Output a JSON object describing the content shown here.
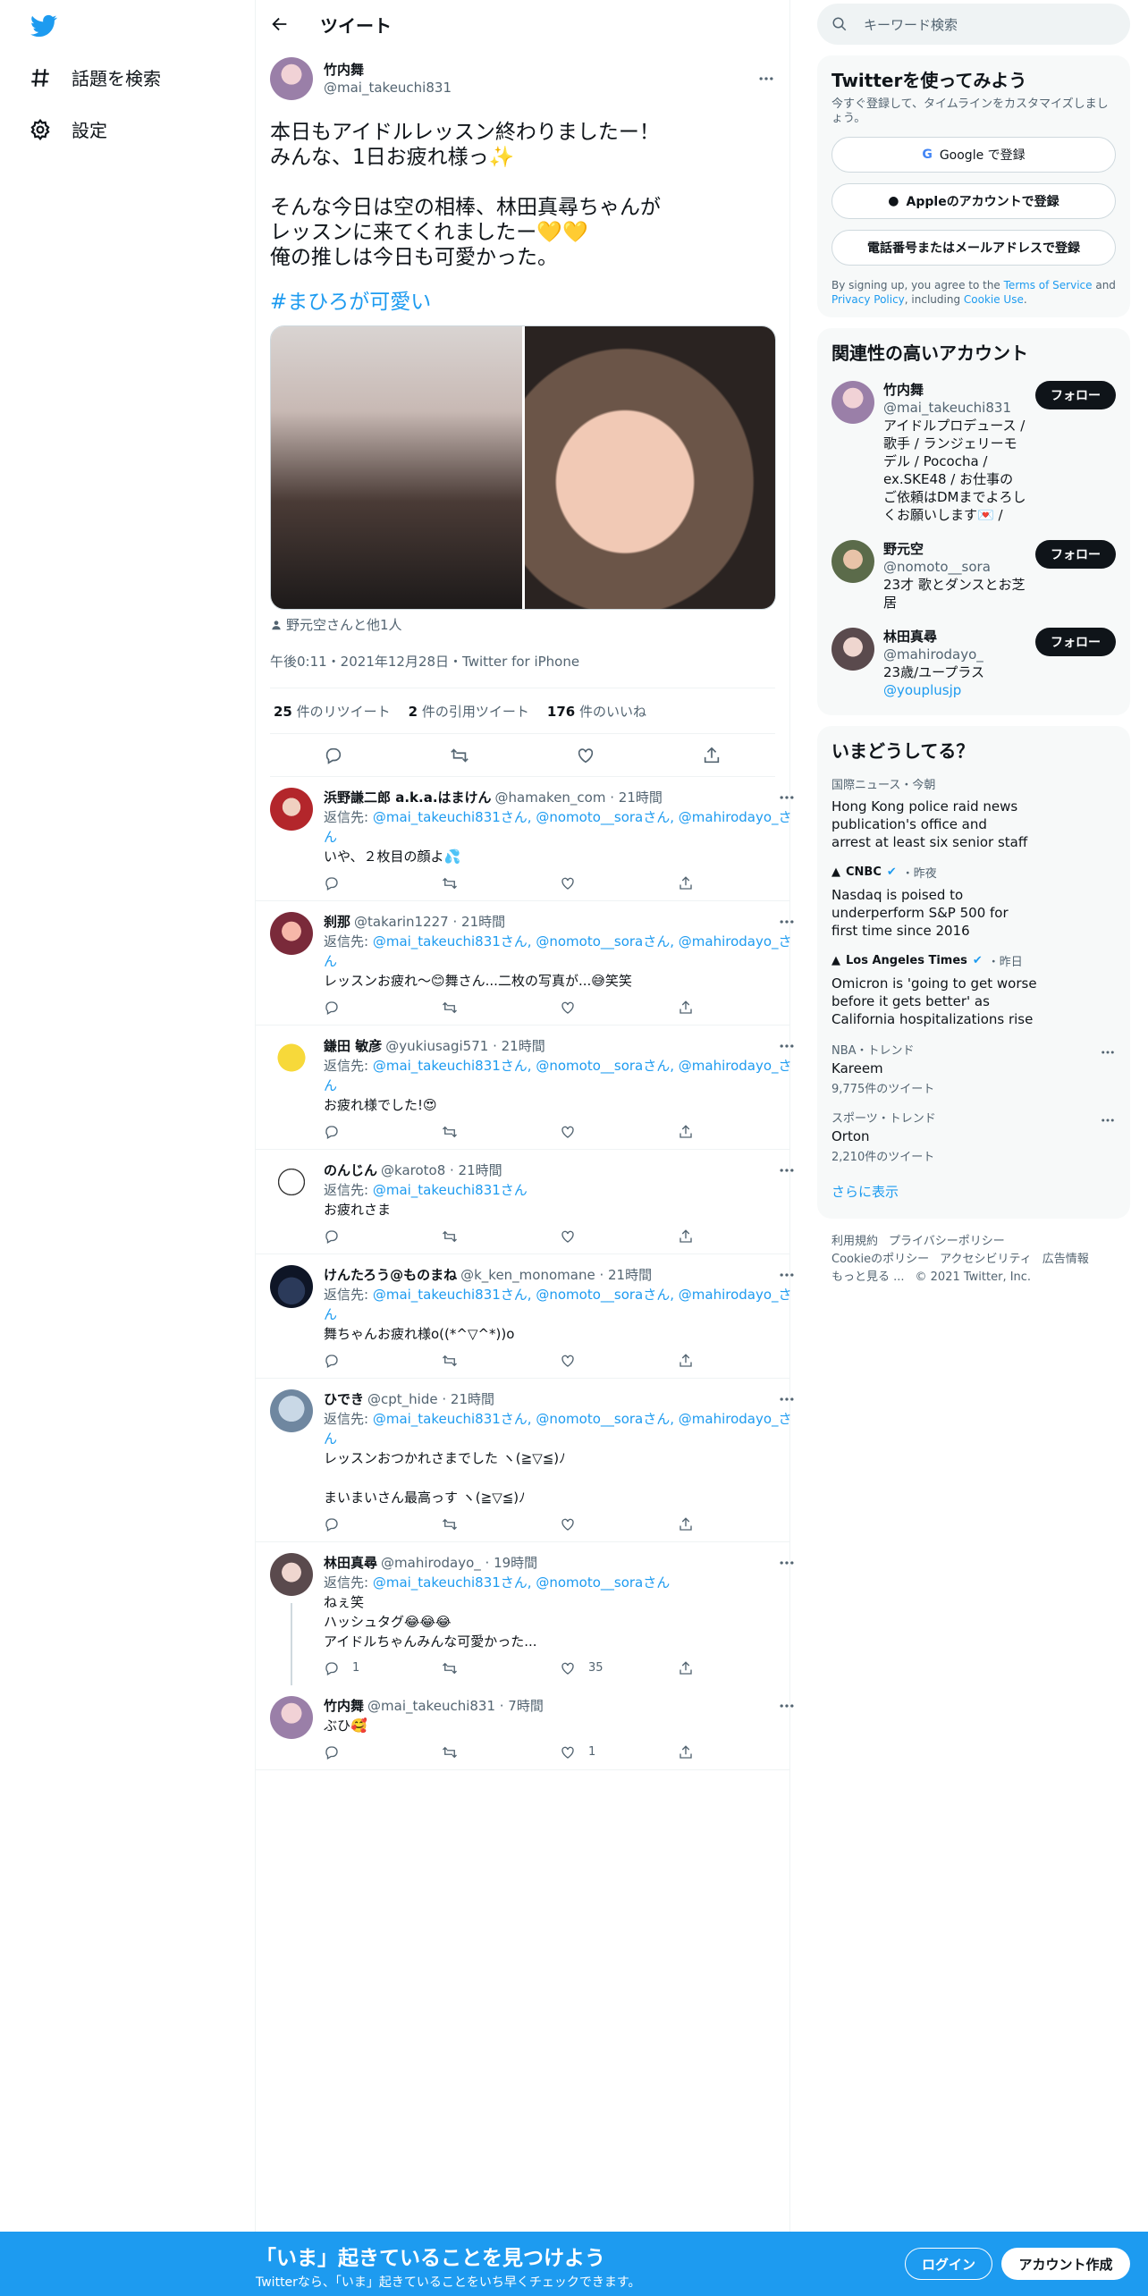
{
  "nav": {
    "explore_label": "話題を検索",
    "settings_label": "設定"
  },
  "header": {
    "title": "ツイート"
  },
  "focal": {
    "name": "竹内舞",
    "handle": "@mai_takeuchi831",
    "text": "本日もアイドルレッスン終わりましたー！\nみんな、1日お疲れ様っ✨\n\nそんな今日は空の相棒、林田真尋ちゃんが\nレッスンに来てくれましたー💛💛\n俺の推しは今日も可愛かった。",
    "hashtag": "#まひろが可愛い",
    "tagged": "野元空さんと他1人",
    "timestamp": "午後0:11・2021年12月28日・Twitter for iPhone",
    "retweets": "25",
    "retweets_label": "件のリツイート",
    "quotes": "2",
    "quotes_label": "件の引用ツイート",
    "likes": "176",
    "likes_label": "件のいいね"
  },
  "replies": [
    {
      "name": "浜野謙二郎 a.k.a.はまけん",
      "handle": "@hamaken_com · 21時間",
      "to_prefix": "返信先: ",
      "to": "@mai_takeuchi831さん, @nomoto__soraさん, @mahirodayo_さん",
      "text": "いや、２枚目の顔よ💦",
      "reply_count": "",
      "like_count": ""
    },
    {
      "name": "刹那",
      "handle": "@takarin1227 · 21時間",
      "to_prefix": "返信先: ",
      "to": "@mai_takeuchi831さん, @nomoto__soraさん, @mahirodayo_さん",
      "text": "レッスンお疲れ～😊舞さん...二枚の写真が...😅笑笑",
      "reply_count": "",
      "like_count": ""
    },
    {
      "name": "鎌田 敏彦",
      "handle": "@yukiusagi571 · 21時間",
      "to_prefix": "返信先: ",
      "to": "@mai_takeuchi831さん, @nomoto__soraさん, @mahirodayo_さん",
      "text": "お疲れ様でした!😍",
      "reply_count": "",
      "like_count": ""
    },
    {
      "name": "のんじん",
      "handle": "@karoto8 · 21時間",
      "to_prefix": "返信先: ",
      "to": "@mai_takeuchi831さん",
      "text": "お疲れさま",
      "reply_count": "",
      "like_count": ""
    },
    {
      "name": "けんたろう@ものまね",
      "handle": "@k_ken_monomane · 21時間",
      "to_prefix": "返信先: ",
      "to": "@mai_takeuchi831さん, @nomoto__soraさん, @mahirodayo_さん",
      "text": "舞ちゃんお疲れ様o((*^▽^*))o",
      "reply_count": "",
      "like_count": ""
    },
    {
      "name": "ひでき",
      "handle": "@cpt_hide · 21時間",
      "to_prefix": "返信先: ",
      "to": "@mai_takeuchi831さん, @nomoto__soraさん, @mahirodayo_さん",
      "text": "レッスンおつかれさまでした ヽ(≧▽≦)ﾉ\n\nまいまいさん最高っす ヽ(≧▽≦)ﾉ",
      "reply_count": "",
      "like_count": ""
    },
    {
      "name": "林田真尋",
      "handle": "@mahirodayo_ · 19時間",
      "to_prefix": "返信先: ",
      "to": "@mai_takeuchi831さん, @nomoto__soraさん",
      "text": "ねぇ笑\nハッシュタグ😂😂😂\nアイドルちゃんみんな可愛かった...",
      "reply_count": "1",
      "like_count": "35"
    },
    {
      "name": "竹内舞",
      "handle": "@mai_takeuchi831 · 7時間",
      "to_prefix": "",
      "to": "",
      "text": "ぶひ🥰",
      "reply_count": "",
      "like_count": "1"
    }
  ],
  "search": {
    "placeholder": "キーワード検索"
  },
  "signup_card": {
    "title": "Twitterを使ってみよう",
    "subtitle": "今すぐ登録して、タイムラインをカスタマイズしましょう。",
    "google": "Google で登録",
    "apple": "Appleのアカウントで登録",
    "phone": "電話番号またはメールアドレスで登録",
    "legal_1": "By signing up, you agree to the ",
    "terms": "Terms of Service",
    "legal_2": " and ",
    "privacy": "Privacy Policy",
    "legal_3": ", including ",
    "cookie": "Cookie Use",
    "legal_4": "."
  },
  "related": {
    "title": "関連性の高いアカウント",
    "follow_label": "フォロー",
    "accounts": [
      {
        "name": "竹内舞",
        "handle": "@mai_takeuchi831",
        "bio": "アイドルプロデュース / 歌手 / ランジェリーモデル / Pococha / ex.SKE48 / お仕事のご依頼はDMまでよろしくお願いします💌 /"
      },
      {
        "name": "野元空",
        "handle": "@nomoto__sora",
        "bio": "23才 歌とダンスとお芝居"
      },
      {
        "name": "林田真尋",
        "handle": "@mahirodayo_",
        "bio": "23歳/ユープラス ",
        "bio_link": "@youplusjp"
      }
    ]
  },
  "trends": {
    "title": "いまどうしてる？",
    "items": [
      {
        "meta": "国際ニュース・今朝",
        "title": "Hong Kong police raid news publication's office and arrest at least six senior staff",
        "source": "",
        "time": "",
        "count": ""
      },
      {
        "meta": "",
        "source": "CNBC",
        "time": "・昨夜",
        "title": "Nasdaq is poised to underperform S&P 500 for first time since 2016",
        "count": ""
      },
      {
        "meta": "",
        "source": "Los Angeles Times",
        "time": "・昨日",
        "title": "Omicron is 'going to get worse before it gets better' as California hospitalizations rise",
        "count": ""
      },
      {
        "meta": "NBA・トレンド",
        "title": "Kareem",
        "source": "",
        "time": "",
        "count": "9,775件のツイート"
      },
      {
        "meta": "スポーツ・トレンド",
        "title": "Orton",
        "source": "",
        "time": "",
        "count": "2,210件のツイート"
      }
    ],
    "show_more": "さらに表示"
  },
  "footer": {
    "terms": "利用規約",
    "privacy": "プライバシーポリシー",
    "cookie": "Cookieのポリシー",
    "accessibility": "アクセシビリティ",
    "ads": "広告情報",
    "more": "もっと見る ...",
    "copyright": "© 2021 Twitter, Inc."
  },
  "bottombar": {
    "headline": "「いま」起きていることを見つけよう",
    "subline": "Twitterなら、「いま」起きていることをいち早くチェックできます。",
    "login": "ログイン",
    "signup": "アカウント作成"
  },
  "colors": {
    "accent": "#1d9bf0",
    "text": "#0f1419",
    "muted": "#536471",
    "border": "#eff3f4"
  }
}
